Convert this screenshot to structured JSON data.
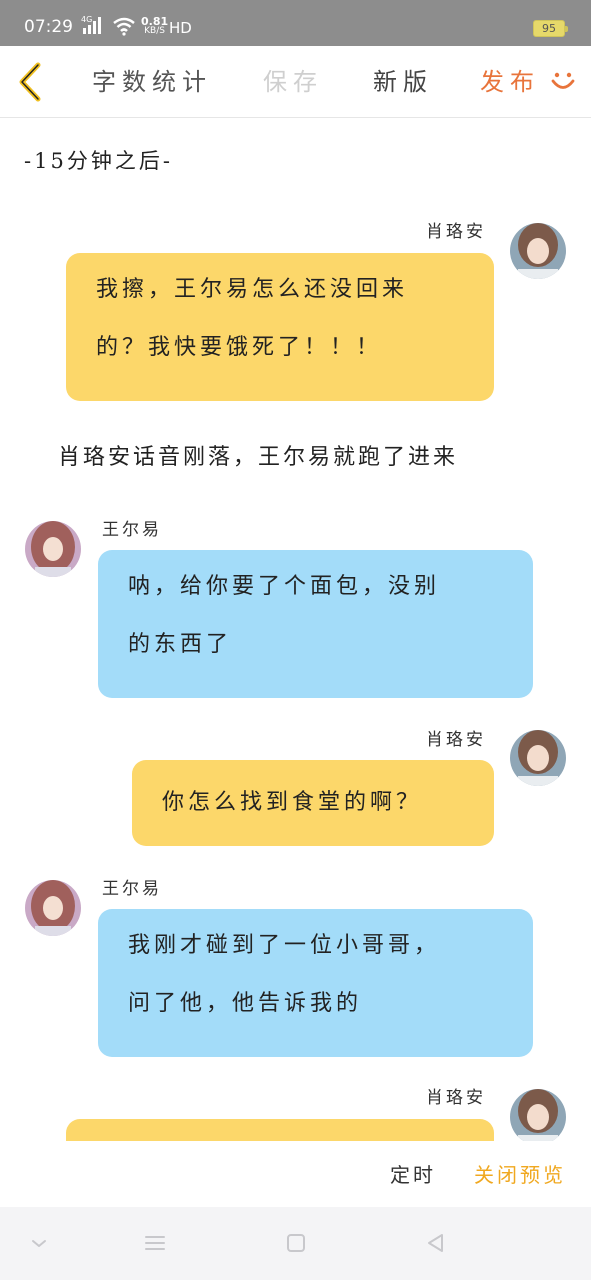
{
  "status_bar": {
    "time": "07:29",
    "signal_label": "4G",
    "speed_value": "0.81",
    "speed_unit": "KB/S",
    "hd": "HD",
    "battery": "95"
  },
  "toolbar": {
    "word_count": "字数统计",
    "save": "保存",
    "new_version": "新版",
    "publish": "发布",
    "accent_color": "#e8743b"
  },
  "story": {
    "scene_marker": "-15分钟之后-",
    "narration_1": "肖珞安话音刚落，王尔易就跑了进来"
  },
  "messages": [
    {
      "side": "right",
      "name": "肖珞安",
      "lines": [
        "我擦，王尔易怎么还没回来",
        "的？我快要饿死了！！！"
      ],
      "color": "#fcd76a"
    },
    {
      "side": "left",
      "name": "王尔易",
      "lines": [
        "呐，给你要了个面包，没别",
        "的东西了"
      ],
      "color": "#a3dcf9"
    },
    {
      "side": "right",
      "name": "肖珞安",
      "lines": [
        "你怎么找到食堂的啊？"
      ],
      "color": "#fcd76a"
    },
    {
      "side": "left",
      "name": "王尔易",
      "lines": [
        "我刚才碰到了一位小哥哥，",
        "问了他，他告诉我的"
      ],
      "color": "#a3dcf9"
    },
    {
      "side": "right",
      "name": "肖珞安",
      "lines": [
        ""
      ],
      "color": "#fcd76a"
    }
  ],
  "action_bar": {
    "timer": "定时",
    "close_preview": "关闭预览",
    "close_color": "#f0a820"
  },
  "icons": {
    "back": "back-chevron-icon",
    "smile": "smile-icon",
    "nav_down": "chevron-down-icon",
    "nav_menu": "menu-icon",
    "nav_home": "home-square-icon",
    "nav_back": "back-triangle-icon"
  }
}
